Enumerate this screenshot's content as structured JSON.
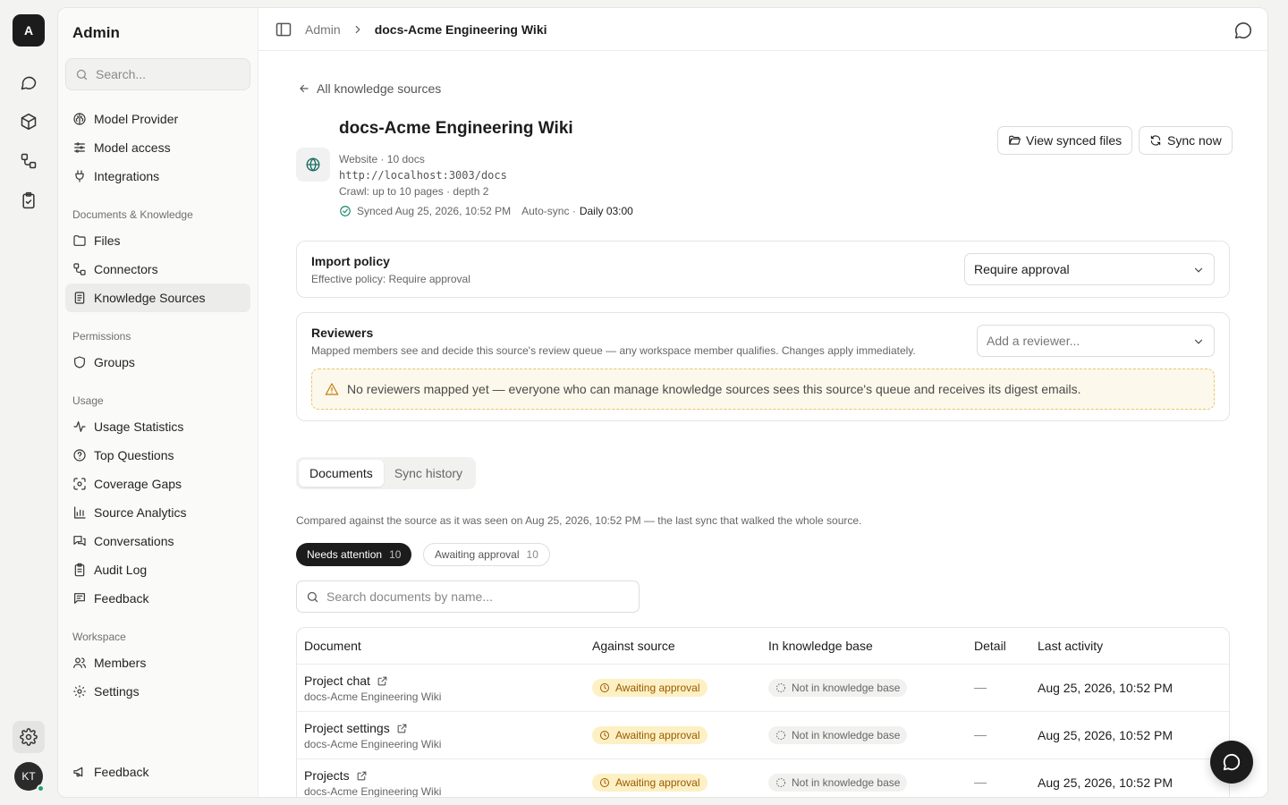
{
  "rail": {
    "logo": "A",
    "avatar": "KT"
  },
  "sidebar": {
    "title": "Admin",
    "search_placeholder": "Search...",
    "items_top": [
      {
        "label": "Model Provider",
        "icon": "brain-icon"
      },
      {
        "label": "Model access",
        "icon": "sliders-icon"
      },
      {
        "label": "Integrations",
        "icon": "plug-icon"
      }
    ],
    "groups": [
      {
        "title": "Documents & Knowledge",
        "items": [
          {
            "label": "Files",
            "icon": "folder-icon"
          },
          {
            "label": "Connectors",
            "icon": "connectors-icon"
          },
          {
            "label": "Knowledge Sources",
            "icon": "book-icon",
            "active": true
          }
        ]
      },
      {
        "title": "Permissions",
        "items": [
          {
            "label": "Groups",
            "icon": "shield-icon"
          }
        ]
      },
      {
        "title": "Usage",
        "items": [
          {
            "label": "Usage Statistics",
            "icon": "activity-icon"
          },
          {
            "label": "Top Questions",
            "icon": "question-icon"
          },
          {
            "label": "Coverage Gaps",
            "icon": "scan-icon"
          },
          {
            "label": "Source Analytics",
            "icon": "bar-chart-icon"
          },
          {
            "label": "Conversations",
            "icon": "messages-icon"
          },
          {
            "label": "Audit Log",
            "icon": "clipboard-icon"
          },
          {
            "label": "Feedback",
            "icon": "feedback-icon"
          }
        ]
      },
      {
        "title": "Workspace",
        "items": [
          {
            "label": "Members",
            "icon": "users-icon"
          },
          {
            "label": "Settings",
            "icon": "gear-icon"
          }
        ]
      }
    ],
    "bottom_item": "Feedback"
  },
  "header": {
    "crumb_root": "Admin",
    "crumb_current": "docs-Acme Engineering Wiki"
  },
  "source": {
    "back_label": "All knowledge sources",
    "title": "docs-Acme Engineering Wiki",
    "type_line": "Website · 10 docs",
    "url": "http://localhost:3003/docs",
    "crawl_line": "Crawl: up to 10 pages · depth 2",
    "synced": "Synced Aug 25, 2026, 10:52 PM",
    "autosync_label": "Auto-sync ·",
    "autosync_schedule": "Daily 03:00",
    "view_files_label": "View synced files",
    "sync_now_label": "Sync now"
  },
  "import_policy": {
    "title": "Import policy",
    "subtitle": "Effective policy: Require approval",
    "selected": "Require approval"
  },
  "reviewers": {
    "title": "Reviewers",
    "subtitle": "Mapped members see and decide this source's review queue — any workspace member qualifies. Changes apply immediately.",
    "placeholder": "Add a reviewer...",
    "warning": "No reviewers mapped yet — everyone who can manage knowledge sources sees this source's queue and receives its digest emails."
  },
  "tabs": {
    "documents": "Documents",
    "sync_history": "Sync history"
  },
  "compare_note": "Compared against the source as it was seen on Aug 25, 2026, 10:52 PM — the last sync that walked the whole source.",
  "filters": {
    "needs_attention": {
      "label": "Needs attention",
      "count": "10"
    },
    "awaiting_approval": {
      "label": "Awaiting approval",
      "count": "10"
    }
  },
  "doc_search_placeholder": "Search documents by name...",
  "table": {
    "headers": {
      "document": "Document",
      "against_source": "Against source",
      "in_kb": "In knowledge base",
      "detail": "Detail",
      "last_activity": "Last activity"
    },
    "rows": [
      {
        "name": "Project chat",
        "source": "docs-Acme Engineering Wiki",
        "against": "Awaiting approval",
        "kb": "Not in knowledge base",
        "detail": "—",
        "last": "Aug 25, 2026, 10:52 PM"
      },
      {
        "name": "Project settings",
        "source": "docs-Acme Engineering Wiki",
        "against": "Awaiting approval",
        "kb": "Not in knowledge base",
        "detail": "—",
        "last": "Aug 25, 2026, 10:52 PM"
      },
      {
        "name": "Projects",
        "source": "docs-Acme Engineering Wiki",
        "against": "Awaiting approval",
        "kb": "Not in knowledge base",
        "detail": "—",
        "last": "Aug 25, 2026, 10:52 PM"
      }
    ]
  }
}
